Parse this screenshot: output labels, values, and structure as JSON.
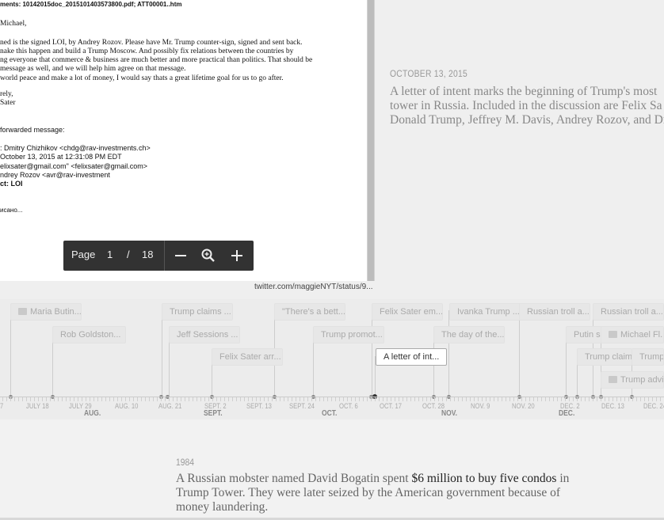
{
  "document": {
    "lines": [
      {
        "t": "ments:  10142015doc_2015101403573800.pdf; ATT00001..htm"
      },
      {
        "t": "Michael,"
      },
      {
        "t": "ned is the signed LOI, by Andrey Rozov. Please have Mr. Trump counter-sign, signed and sent back."
      },
      {
        "t": "nake this happen and build a Trump Moscow. And possibly fix relations between the countries by"
      },
      {
        "t": "ng everyone that commerce & business are much better and more practical than politics. That should be"
      },
      {
        "t": " message as well, and we will help him agree on that message."
      },
      {
        "t": "world peace and make a lot of money, I would say thats a great lifetime goal for us to go after."
      },
      {
        "t": "rely,"
      },
      {
        "t": "Sater"
      },
      {
        "t": " forwarded message:"
      },
      {
        "t": ": Dmitry Chizhikov <chdg@rav-investments.ch>"
      },
      {
        "t": " October 13, 2015 at 12:31:08 PM EDT"
      },
      {
        "t": "elixsater@gmail.com\" <felixsater@gmail.com>"
      },
      {
        "t": "ndrey Rozov <avr@rav-investment"
      },
      {
        "t": "ct: LOI"
      },
      {
        "t": "исано..."
      }
    ]
  },
  "pdf_toolbar": {
    "page_label": "Page",
    "current_page": "1",
    "separator": "/",
    "total_pages": "18",
    "zoom_out_icon": "minus-icon",
    "fit_icon": "magnifier-icon",
    "zoom_in_icon": "plus-icon"
  },
  "credit": "twitter.com/maggieNYT/status/9...",
  "slide": {
    "date": "OCTOBER 13, 2015",
    "body_lines": [
      "A letter of intent marks the beginning of Trump's most",
      "tower in Russia. Included in the discussion are Felix Sa",
      "Donald Trump, Jeffrey M. Davis, Andrey Rozov, and Dr"
    ]
  },
  "timeline": {
    "markers": [
      {
        "label": "Maria Butin...",
        "icon": "image-icon"
      },
      {
        "label": "Rob Goldston..."
      },
      {
        "label": "Trump claims ..."
      },
      {
        "label": "Jeff Sessions ..."
      },
      {
        "label": "Felix Sater arr..."
      },
      {
        "label": "\"There's a bett..."
      },
      {
        "label": "Trump promot..."
      },
      {
        "label": "Felix Sater em..."
      },
      {
        "label": "A letter of int..."
      },
      {
        "label": "Ivanka Trump ..."
      },
      {
        "label": "The day of the..."
      },
      {
        "label": "Russian troll a..."
      },
      {
        "label": "Putin sa"
      },
      {
        "label": "Russian troll a..."
      },
      {
        "label": "Michael Fl...",
        "icon": "image-icon"
      },
      {
        "label": "Trump claim"
      },
      {
        "label": "Trump"
      },
      {
        "label": "Trump advis...",
        "icon": "image-icon"
      }
    ],
    "tick_labels": [
      "7",
      "JULY 18",
      "JULY 29",
      "AUG. 10",
      "AUG. 21",
      "SEPT. 2",
      "SEPT. 13",
      "SEPT. 24",
      "OCT. 6",
      "OCT. 17",
      "OCT. 28",
      "NOV. 9",
      "NOV. 20",
      "DEC. 2",
      "DEC. 13",
      "DEC. 24"
    ],
    "month_labels": [
      "AUG.",
      "SEPT.",
      "OCT.",
      "NOV.",
      "DEC."
    ]
  },
  "next_slide": {
    "date": "1984",
    "text_before": "A Russian mobster named David Bogatin spent ",
    "link": "$6 million to buy five condos",
    "text_after": " in Trump Tower. They were later seized by the American government because of money laundering."
  },
  "colors": {
    "accent_dark": "#323232",
    "marker_bg": "#e7e7e7",
    "active_marker": "#ffffff"
  }
}
